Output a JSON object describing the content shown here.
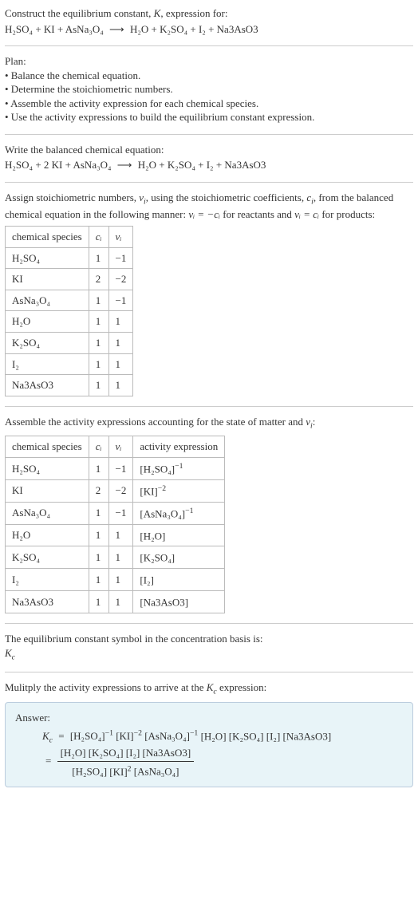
{
  "intro": {
    "line1_pre": "Construct the equilibrium constant, ",
    "K": "K",
    "line1_post": ", expression for:",
    "equation_lhs": "H₂SO₄ + KI + AsNa₃O₄",
    "arrow": "⟶",
    "equation_rhs": "H₂O + K₂SO₄ + I₂ + Na3AsO3"
  },
  "plan": {
    "heading": "Plan:",
    "b1": "• Balance the chemical equation.",
    "b2": "• Determine the stoichiometric numbers.",
    "b3": "• Assemble the activity expression for each chemical species.",
    "b4": "• Use the activity expressions to build the equilibrium constant expression."
  },
  "balanced": {
    "heading": "Write the balanced chemical equation:",
    "lhs": "H₂SO₄ + 2 KI + AsNa₃O₄",
    "arrow": "⟶",
    "rhs": "H₂O + K₂SO₄ + I₂ + Na3AsO3"
  },
  "stoich": {
    "text_pre": "Assign stoichiometric numbers, ",
    "nu": "ν",
    "sub_i": "i",
    "text_mid1": ", using the stoichiometric coefficients, ",
    "c": "c",
    "text_mid2": ", from the balanced chemical equation in the following manner: ",
    "rel_react": "νᵢ = −cᵢ",
    "text_mid3": " for reactants and ",
    "rel_prod": "νᵢ = cᵢ",
    "text_mid4": " for products:",
    "headers": {
      "h1": "chemical species",
      "h2": "cᵢ",
      "h3": "νᵢ"
    },
    "rows": [
      {
        "sp": "H₂SO₄",
        "c": "1",
        "v": "−1"
      },
      {
        "sp": "KI",
        "c": "2",
        "v": "−2"
      },
      {
        "sp": "AsNa₃O₄",
        "c": "1",
        "v": "−1"
      },
      {
        "sp": "H₂O",
        "c": "1",
        "v": "1"
      },
      {
        "sp": "K₂SO₄",
        "c": "1",
        "v": "1"
      },
      {
        "sp": "I₂",
        "c": "1",
        "v": "1"
      },
      {
        "sp": "Na3AsO3",
        "c": "1",
        "v": "1"
      }
    ]
  },
  "activity": {
    "heading_pre": "Assemble the activity expressions accounting for the state of matter and ",
    "heading_post": ":",
    "headers": {
      "h1": "chemical species",
      "h2": "cᵢ",
      "h3": "νᵢ",
      "h4": "activity expression"
    },
    "rows": [
      {
        "sp": "H₂SO₄",
        "c": "1",
        "v": "−1",
        "a_base": "[H₂SO₄]",
        "a_exp": "−1"
      },
      {
        "sp": "KI",
        "c": "2",
        "v": "−2",
        "a_base": "[KI]",
        "a_exp": "−2"
      },
      {
        "sp": "AsNa₃O₄",
        "c": "1",
        "v": "−1",
        "a_base": "[AsNa₃O₄]",
        "a_exp": "−1"
      },
      {
        "sp": "H₂O",
        "c": "1",
        "v": "1",
        "a_base": "[H₂O]",
        "a_exp": ""
      },
      {
        "sp": "K₂SO₄",
        "c": "1",
        "v": "1",
        "a_base": "[K₂SO₄]",
        "a_exp": ""
      },
      {
        "sp": "I₂",
        "c": "1",
        "v": "1",
        "a_base": "[I₂]",
        "a_exp": ""
      },
      {
        "sp": "Na3AsO3",
        "c": "1",
        "v": "1",
        "a_base": "[Na3AsO3]",
        "a_exp": ""
      }
    ]
  },
  "symbol": {
    "line": "The equilibrium constant symbol in the concentration basis is:",
    "Kc_K": "K",
    "Kc_c": "c"
  },
  "multiply": {
    "line_pre": "Mulitply the activity expressions to arrive at the ",
    "line_post": " expression:"
  },
  "answer": {
    "label": "Answer:",
    "Kc_K": "K",
    "Kc_c": "c",
    "eq": "=",
    "prod_t1b": "[H₂SO₄]",
    "prod_t1e": "−1",
    "prod_t2b": "[KI]",
    "prod_t2e": "−2",
    "prod_t3b": "[AsNa₃O₄]",
    "prod_t3e": "−1",
    "prod_t4": "[H₂O]",
    "prod_t5": "[K₂SO₄]",
    "prod_t6": "[I₂]",
    "prod_t7": "[Na3AsO3]",
    "frac_num": "[H₂O] [K₂SO₄] [I₂] [Na3AsO3]",
    "frac_den_t1": "[H₂SO₄]",
    "frac_den_t2b": "[KI]",
    "frac_den_t2e": "2",
    "frac_den_t3": "[AsNa₃O₄]"
  }
}
